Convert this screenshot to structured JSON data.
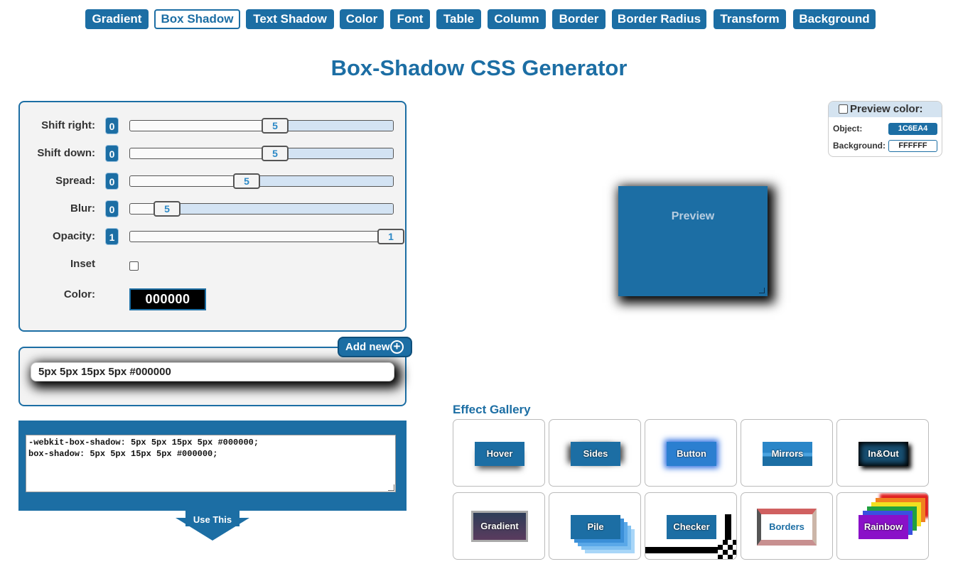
{
  "nav": {
    "items": [
      "Gradient",
      "Box Shadow",
      "Text Shadow",
      "Color",
      "Font",
      "Table",
      "Column",
      "Border",
      "Border Radius",
      "Transform",
      "Background"
    ],
    "active": "Box Shadow"
  },
  "page_title": "Box-Shadow CSS Generator",
  "controls": {
    "shift_right": {
      "label": "Shift right:",
      "badge": "0",
      "handle": "5",
      "level": 0.55
    },
    "shift_down": {
      "label": "Shift down:",
      "badge": "0",
      "handle": "5",
      "level": 0.55
    },
    "spread": {
      "label": "Spread:",
      "badge": "0",
      "handle": "5",
      "level": 0.44
    },
    "blur": {
      "label": "Blur:",
      "badge": "0",
      "handle": "5",
      "level": 0.13
    },
    "opacity": {
      "label": "Opacity:",
      "badge": "1",
      "handle": "1",
      "level": 1.0
    },
    "inset": {
      "label": "Inset",
      "checked": false
    },
    "color": {
      "label": "Color:",
      "value": "000000"
    }
  },
  "layers": {
    "add_new_label": "Add new",
    "items": [
      "5px 5px 15px 5px #000000"
    ]
  },
  "code": {
    "line1": "-webkit-box-shadow: 5px 5px 15px 5px #000000;",
    "line2": "box-shadow: 5px 5px 15px 5px #000000;",
    "use_this_label": "Use This"
  },
  "preview_color": {
    "title": "Preview color:",
    "checked": false,
    "object_label": "Object:",
    "object_value": "1C6EA4",
    "background_label": "Background:",
    "background_value": "FFFFFF"
  },
  "preview": {
    "label": "Preview"
  },
  "gallery": {
    "title": "Effect Gallery",
    "items": [
      "Hover",
      "Sides",
      "Button",
      "Mirrors",
      "In&Out",
      "Gradient",
      "Pile",
      "Checker",
      "Borders",
      "Rainbow"
    ]
  },
  "colors": {
    "accent": "#1c6ea4",
    "panel_bg": "#f3f3f3",
    "slider_fill": "#d3e3f3"
  }
}
